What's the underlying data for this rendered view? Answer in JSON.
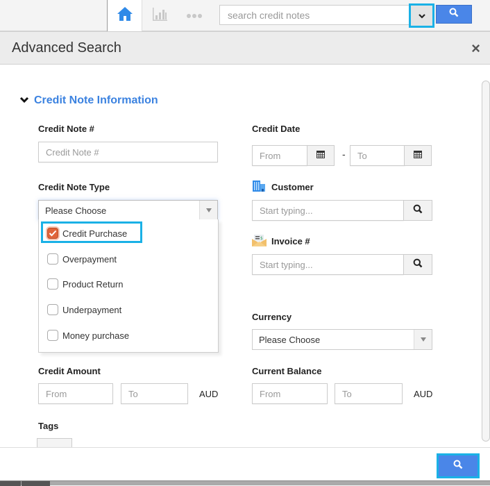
{
  "topbar": {
    "nav": [
      {
        "icon": "home-icon",
        "active": true
      },
      {
        "icon": "bar-chart-icon",
        "active": false
      },
      {
        "icon": "more-dots-icon",
        "active": false
      }
    ],
    "search": {
      "placeholder": "search credit notes"
    },
    "colors": {
      "accent": "#4a86e8",
      "highlight": "#1ab1e6"
    }
  },
  "modal": {
    "title": "Advanced Search",
    "close_label": "×",
    "section": {
      "title": "Credit Note Information",
      "expanded": true
    },
    "fields": {
      "credit_note_no": {
        "label": "Credit Note #",
        "placeholder": "Credit Note #"
      },
      "credit_date": {
        "label": "Credit Date",
        "from_placeholder": "From",
        "to_placeholder": "To",
        "separator": "-"
      },
      "credit_note_type": {
        "label": "Credit Note Type",
        "selected": "Please Choose",
        "options": [
          {
            "label": "Credit Purchase",
            "checked": true
          },
          {
            "label": "Overpayment",
            "checked": false
          },
          {
            "label": "Product Return",
            "checked": false
          },
          {
            "label": "Underpayment",
            "checked": false
          },
          {
            "label": "Money purchase",
            "checked": false
          }
        ]
      },
      "customer": {
        "label": "Customer",
        "placeholder": "Start typing..."
      },
      "invoice": {
        "label": "Invoice #",
        "placeholder": "Start typing..."
      },
      "currency": {
        "label": "Currency",
        "selected": "Please Choose"
      },
      "credit_amount": {
        "label": "Credit Amount",
        "from_placeholder": "From",
        "to_placeholder": "To",
        "unit": "AUD"
      },
      "current_balance": {
        "label": "Current Balance",
        "from_placeholder": "From",
        "to_placeholder": "To",
        "unit": "AUD"
      },
      "tags": {
        "label": "Tags"
      }
    }
  }
}
